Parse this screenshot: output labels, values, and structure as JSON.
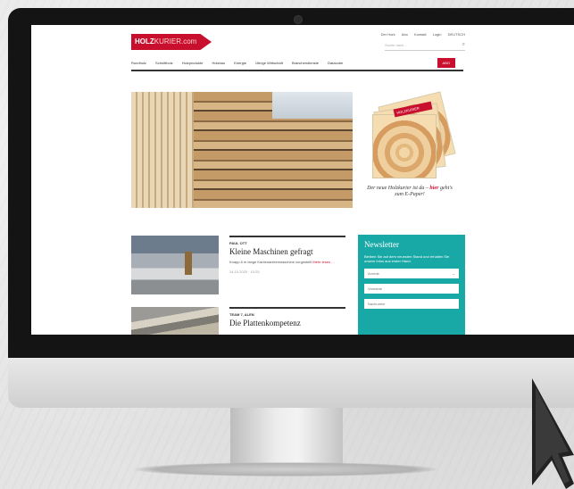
{
  "site": {
    "logo": {
      "prefix": "HOLZ",
      "suffix": "KURIER.com"
    },
    "top_links": [
      "Der Hork",
      "Abo",
      "Kontakt",
      "Login",
      "DEUTSCH"
    ],
    "search": {
      "placeholder": "Suche nach ..."
    },
    "main_nav": [
      "Rundholz",
      "Schnittholz",
      "Holzprodukte",
      "Holzbau",
      "Energie",
      "Übrige Wirtschaft",
      "Branchendienste",
      "Datacube"
    ],
    "abo_button": "ABO",
    "epaper": {
      "cover_brand": "HOLZKURIER",
      "caption_pre": "Der neue Holzkurier ist da – ",
      "caption_link": "hier",
      "caption_post": " geht's zum E-Paper!"
    },
    "articles": [
      {
        "author": "PAUL OTT",
        "title": "Kleine Maschinen gefragt",
        "teaser": "Knapp 6 m lange Kantenanleimmaschine vorgestellt",
        "more": "Mehr lesen ...",
        "date": "14.10.2020 · 10:25"
      },
      {
        "author": "TEAM 7, ALEN",
        "title": "Die Plattenkompetenz"
      }
    ],
    "newsletter": {
      "title": "Newsletter",
      "text": "Bleiben Sie auf dem neuesten Stand und erhalten Sie unsere Infos aus erster Hand.",
      "salutation": "Anrede",
      "first_name": "Vorname",
      "last_name": "Nachname"
    }
  },
  "colors": {
    "brand_red": "#c8102e",
    "newsletter_teal": "#18a9a6"
  }
}
